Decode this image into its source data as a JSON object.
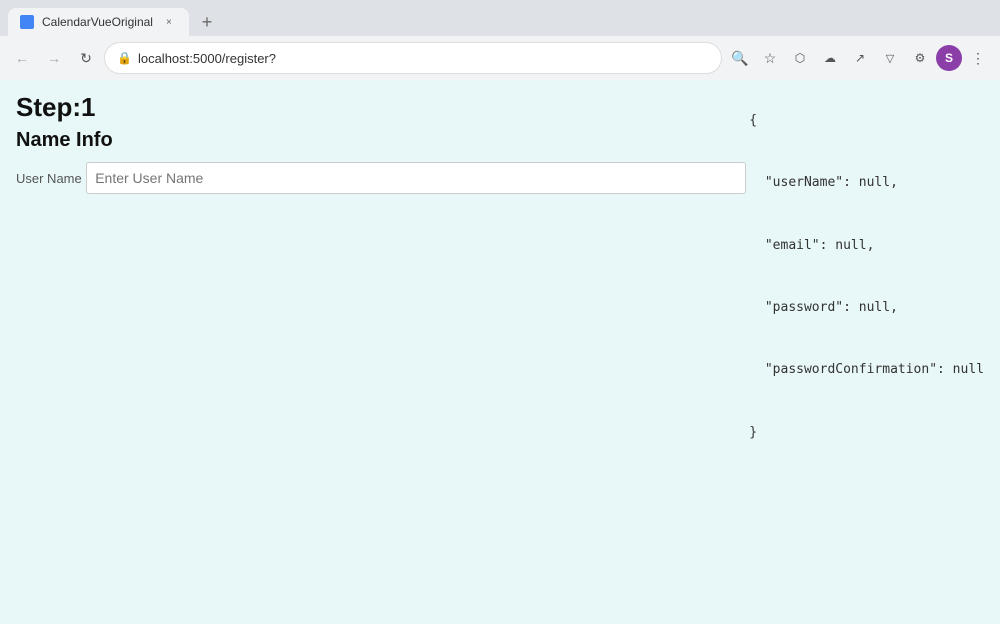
{
  "browser": {
    "tab_label": "CalendarVueOriginal",
    "tab_close_symbol": "×",
    "new_tab_symbol": "+",
    "back_symbol": "←",
    "forward_symbol": "→",
    "reload_symbol": "↻",
    "url": "localhost:5000/register?",
    "lock_symbol": "⊙",
    "search_icon_symbol": "🔍",
    "bookmark_icon_symbol": "☆",
    "cast_icon_symbol": "□",
    "cloud_icon_symbol": "↑",
    "share_icon_symbol": "↗",
    "filter_icon_symbol": "▽",
    "puzzle_icon_symbol": "🧩",
    "more_icon_symbol": "⋮",
    "profile_initial": "S"
  },
  "page": {
    "step_title": "Step:1",
    "section_heading": "Name Info",
    "field_label": "User Name",
    "input_placeholder": "Enter User Name",
    "input_value": ""
  },
  "json_debug": {
    "line1": "{",
    "line2": "  \"userName\": null,",
    "line3": "  \"email\": null,",
    "line4": "  \"password\": null,",
    "line5": "  \"passwordConfirmation\": null",
    "line6": "}"
  }
}
